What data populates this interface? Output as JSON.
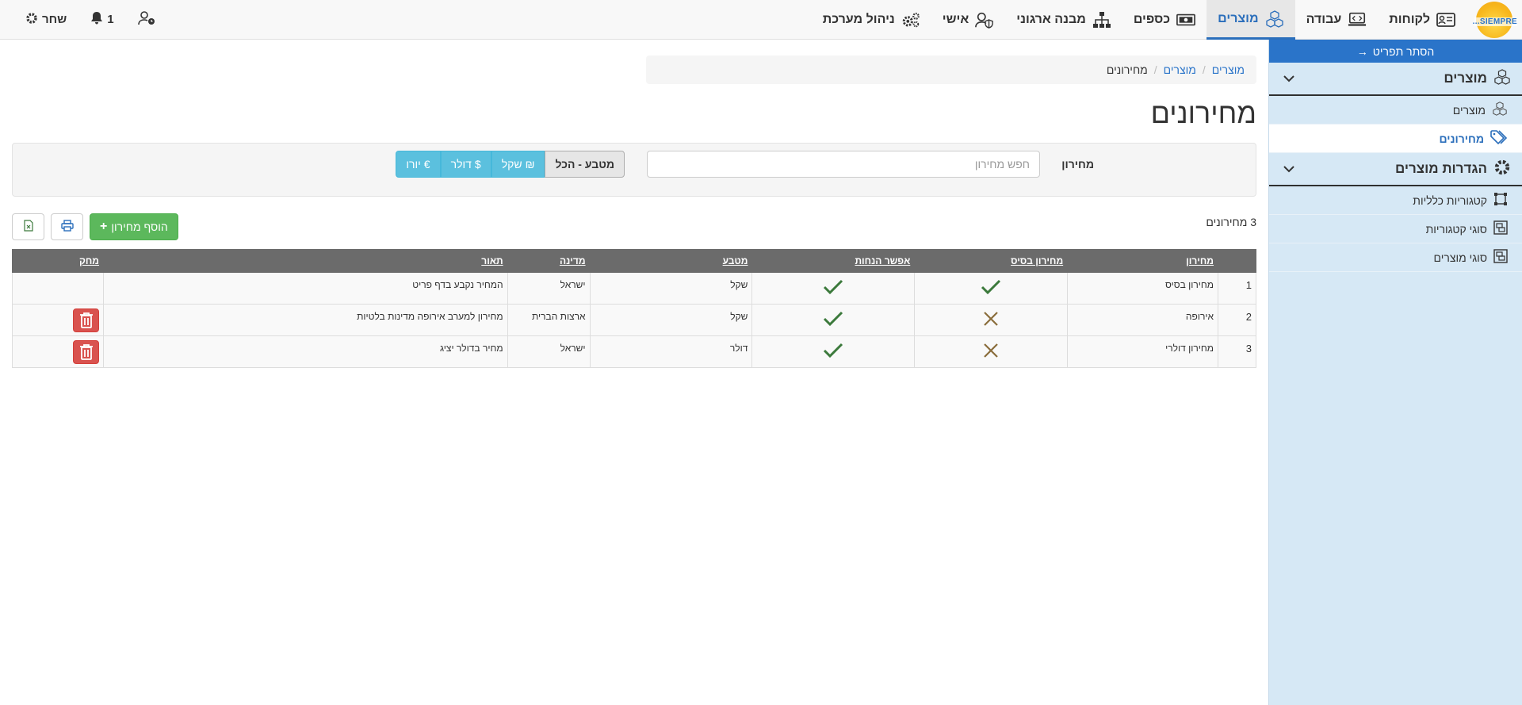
{
  "topnav": {
    "logo_text": "SIEMPRE...",
    "items": [
      {
        "label": "לקוחות",
        "icon": "customer-card-icon"
      },
      {
        "label": "עבודה",
        "icon": "laptop-code-icon"
      },
      {
        "label": "מוצרים",
        "icon": "cubes-icon",
        "active": true
      },
      {
        "label": "כספים",
        "icon": "money-bill-icon"
      },
      {
        "label": "מבנה ארגוני",
        "icon": "sitemap-icon"
      },
      {
        "label": "אישי",
        "icon": "user-shield-icon"
      },
      {
        "label": "ניהול מערכת",
        "icon": "cogs-icon"
      }
    ],
    "user_icon": "user-clock-icon",
    "notifications_count": "1",
    "user_name": "שחר"
  },
  "sidebar": {
    "hide_menu": "הסתר תפריט",
    "hide_arrow": "→",
    "sections": [
      {
        "title": "מוצרים",
        "icon": "cubes-icon",
        "items": [
          {
            "label": "מוצרים",
            "icon": "cubes-icon",
            "active": false
          },
          {
            "label": "מחירונים",
            "icon": "tags-icon",
            "active": true
          }
        ]
      },
      {
        "title": "הגדרות מוצרים",
        "icon": "gear-icon",
        "items": [
          {
            "label": "קטגוריות כלליות",
            "icon": "vector-square-icon"
          },
          {
            "label": "סוגי קטגוריות",
            "icon": "object-group-icon"
          },
          {
            "label": "סוגי מוצרים",
            "icon": "object-group-icon"
          }
        ]
      }
    ]
  },
  "breadcrumb": {
    "items": [
      "מוצרים",
      "מוצרים",
      "מחירונים"
    ],
    "sep": "/"
  },
  "page": {
    "title": "מחירונים",
    "count_text": "3 מחירונים"
  },
  "filter": {
    "label": "מחירון",
    "search_placeholder": "חפש מחירון",
    "currency_buttons": [
      {
        "label": "מטבע - הכל",
        "selected": true
      },
      {
        "label": "שקל",
        "symbol": "₪"
      },
      {
        "label": "דולר",
        "symbol": "$"
      },
      {
        "label": "יורו",
        "symbol": "€"
      }
    ]
  },
  "actions": {
    "add_label": "הוסף מחירון",
    "add_symbol": "+"
  },
  "table": {
    "columns": [
      "",
      "מחירון",
      "מחירון בסיס",
      "אפשר הנחות",
      "מטבע",
      "מדינה",
      "תאור",
      "מחק"
    ],
    "rows": [
      {
        "num": "1",
        "name": "מחירון בסיס",
        "base": true,
        "discounts": true,
        "currency": "שקל",
        "country": "ישראל",
        "desc": "המחיר נקבע בדף פריט",
        "deletable": false
      },
      {
        "num": "2",
        "name": "אירופה",
        "base": false,
        "discounts": true,
        "currency": "שקל",
        "country": "ארצות הברית",
        "desc": "מחירון למערב אירופה מדינות בלטיות",
        "deletable": true
      },
      {
        "num": "3",
        "name": "מחירון דולרי",
        "base": false,
        "discounts": true,
        "currency": "דולר",
        "country": "ישראל",
        "desc": "מחיר בדולר יציג",
        "deletable": true
      }
    ]
  },
  "colors": {
    "accent": "#2a74c9",
    "sidebar_bg": "#d6e8f5",
    "header_bg": "#6b6b6b",
    "check_color": "#3c7a3c",
    "cross_color": "#8a6d3b",
    "danger": "#d9534f",
    "success": "#5cb85c",
    "info": "#5bc0de"
  }
}
